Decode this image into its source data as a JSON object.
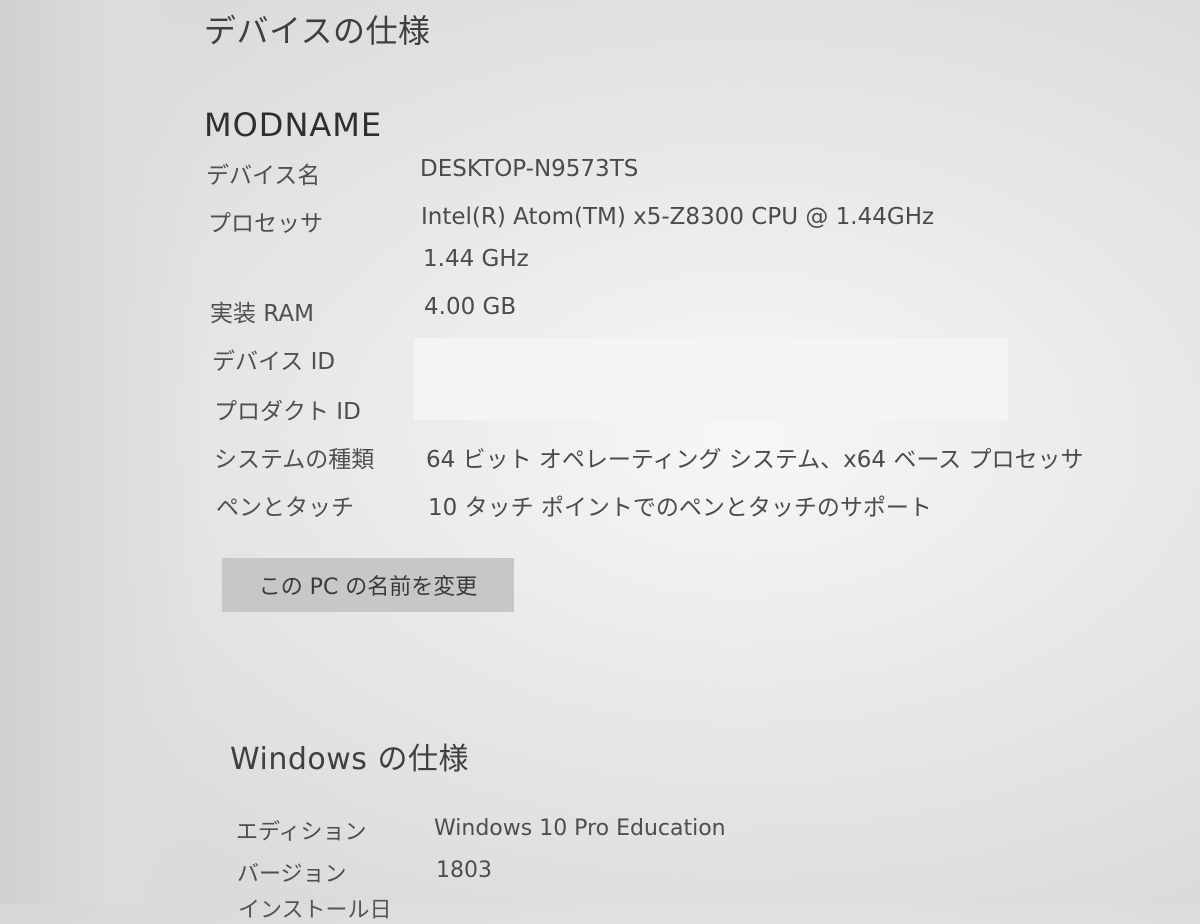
{
  "device_specs": {
    "section_title": "デバイスの仕様",
    "device_heading": "MODNAME",
    "rows": [
      {
        "label": "デバイス名",
        "value": "DESKTOP-N9573TS"
      },
      {
        "label": "プロセッサ",
        "value": "Intel(R) Atom(TM) x5-Z8300  CPU @ 1.44GHz",
        "value2": "1.44 GHz"
      },
      {
        "label": "実装 RAM",
        "value": "4.00 GB"
      },
      {
        "label": "デバイス ID",
        "value": ""
      },
      {
        "label": "プロダクト ID",
        "value": ""
      },
      {
        "label": "システムの種類",
        "value": "64 ビット オペレーティング システム、x64 ベース プロセッサ"
      },
      {
        "label": "ペンとタッチ",
        "value": "10 タッチ ポイントでのペンとタッチのサポート"
      }
    ],
    "rename_button_label": "この PC の名前を変更"
  },
  "windows_specs": {
    "section_title": "Windows の仕様",
    "rows": [
      {
        "label": "エディション",
        "value": "Windows 10 Pro Education"
      },
      {
        "label": "バージョン",
        "value": "1803"
      }
    ],
    "partial_next_label": "インストール日"
  }
}
